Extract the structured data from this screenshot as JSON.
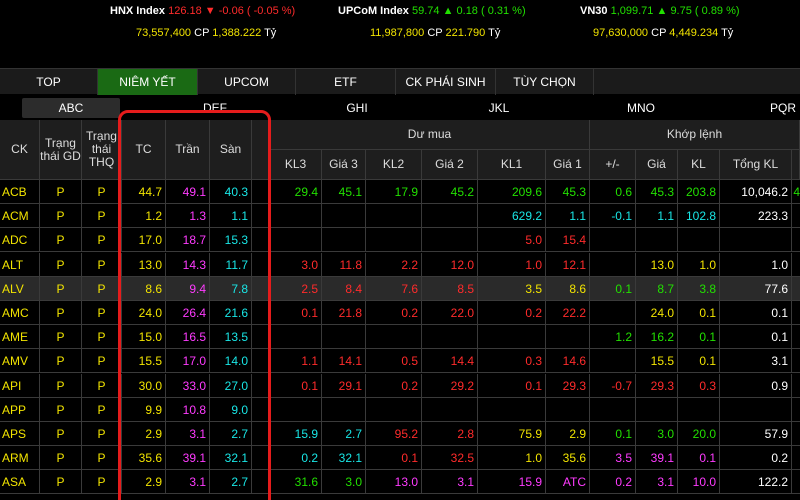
{
  "indices": [
    {
      "name": "HNX Index",
      "value": "126.18",
      "arrow": "▼",
      "change": "-0.06",
      "pct": "( -0.05 %)",
      "color": "#ff2b2b",
      "volume": "73,557,400",
      "cp": "CP",
      "turnover": "1,388.222",
      "unit": "Tỷ"
    },
    {
      "name": "UPCoM Index",
      "value": "59.74",
      "arrow": "▲",
      "change": "0.18",
      "pct": "( 0.31 %)",
      "color": "#22e000",
      "volume": "11,987,800",
      "cp": "CP",
      "turnover": "221.790",
      "unit": "Tỷ"
    },
    {
      "name": "VN30",
      "value": "1,099.71",
      "arrow": "▲",
      "change": "9.75",
      "pct": "( 0.89 %)",
      "color": "#22e000",
      "volume": "97,630,000",
      "cp": "CP",
      "turnover": "4,449.234",
      "unit": "Tỷ"
    }
  ],
  "tabs": [
    {
      "label": "TOP",
      "active": false
    },
    {
      "label": "NIÊM YẾT",
      "active": true
    },
    {
      "label": "UPCOM",
      "active": false
    },
    {
      "label": "ETF",
      "active": false
    },
    {
      "label": "CK PHÁI SINH",
      "active": false
    },
    {
      "label": "TÙY CHỌN",
      "active": false
    }
  ],
  "alpha": [
    "ABC",
    "DEF",
    "GHI",
    "JKL",
    "MNO",
    "PQR"
  ],
  "headers": {
    "ck": "CK",
    "trangthai_gd": "Trạng thái GD",
    "trangthai_thq": "Trạng thái THQ",
    "tc": "TC",
    "tran": "Trần",
    "san": "Sàn",
    "du_mua": "Dư mua",
    "khop_lenh": "Khớp lệnh",
    "kl3": "KL3",
    "gia3": "Giá 3",
    "kl2": "KL2",
    "gia2": "Giá 2",
    "kl1": "KL1",
    "gia1": "Giá 1",
    "change": "+/-",
    "gia": "Giá",
    "kl": "KL",
    "tong_kl": "Tổng KL"
  },
  "colors": {
    "up": "#22e000",
    "down": "#ff2b2b",
    "ref": "#f2e400",
    "ceil": "#ff3bff",
    "floor": "#19e6e6",
    "white": "#ffffff"
  },
  "rows": [
    {
      "ck": "ACB",
      "gd": "P",
      "thq": "P",
      "tc": "44.7",
      "tran": "49.1",
      "san": "40.3",
      "kl3": [
        "29.4",
        "up"
      ],
      "gia3": [
        "45.1",
        "up"
      ],
      "kl2": [
        "17.9",
        "up"
      ],
      "gia2": [
        "45.2",
        "up"
      ],
      "kl1": [
        "209.6",
        "up"
      ],
      "gia1": [
        "45.3",
        "up"
      ],
      "chg": [
        "0.6",
        "up"
      ],
      "gia": [
        "45.3",
        "up"
      ],
      "kl": [
        "203.8",
        "up"
      ],
      "tkl": [
        "10,046.2",
        "white"
      ],
      "extra": [
        "4",
        "up"
      ]
    },
    {
      "ck": "ACM",
      "gd": "P",
      "thq": "P",
      "tc": "1.2",
      "tran": "1.3",
      "san": "1.1",
      "kl3": [
        "",
        ""
      ],
      "gia3": [
        "",
        ""
      ],
      "kl2": [
        "",
        ""
      ],
      "gia2": [
        "",
        ""
      ],
      "kl1": [
        "629.2",
        "floor"
      ],
      "gia1": [
        "1.1",
        "floor"
      ],
      "chg": [
        "-0.1",
        "floor"
      ],
      "gia": [
        "1.1",
        "floor"
      ],
      "kl": [
        "102.8",
        "floor"
      ],
      "tkl": [
        "223.3",
        "white"
      ],
      "extra": [
        "",
        ""
      ]
    },
    {
      "ck": "ADC",
      "gd": "P",
      "thq": "P",
      "tc": "17.0",
      "tran": "18.7",
      "san": "15.3",
      "kl3": [
        "",
        ""
      ],
      "gia3": [
        "",
        ""
      ],
      "kl2": [
        "",
        ""
      ],
      "gia2": [
        "",
        ""
      ],
      "kl1": [
        "5.0",
        "down"
      ],
      "gia1": [
        "15.4",
        "down"
      ],
      "chg": [
        "",
        ""
      ],
      "gia": [
        "",
        ""
      ],
      "kl": [
        "",
        ""
      ],
      "tkl": [
        "",
        ""
      ],
      "extra": [
        "",
        ""
      ]
    },
    {
      "ck": "ALT",
      "gd": "P",
      "thq": "P",
      "tc": "13.0",
      "tran": "14.3",
      "san": "11.7",
      "kl3": [
        "3.0",
        "down"
      ],
      "gia3": [
        "11.8",
        "down"
      ],
      "kl2": [
        "2.2",
        "down"
      ],
      "gia2": [
        "12.0",
        "down"
      ],
      "kl1": [
        "1.0",
        "down"
      ],
      "gia1": [
        "12.1",
        "down"
      ],
      "chg": [
        "",
        ""
      ],
      "gia": [
        "13.0",
        "ref"
      ],
      "kl": [
        "1.0",
        "ref"
      ],
      "tkl": [
        "1.0",
        "white"
      ],
      "extra": [
        "",
        ""
      ]
    },
    {
      "ck": "ALV",
      "gd": "P",
      "thq": "P",
      "tc": "8.6",
      "tran": "9.4",
      "san": "7.8",
      "kl3": [
        "2.5",
        "down"
      ],
      "gia3": [
        "8.4",
        "down"
      ],
      "kl2": [
        "7.6",
        "down"
      ],
      "gia2": [
        "8.5",
        "down"
      ],
      "kl1": [
        "3.5",
        "ref"
      ],
      "gia1": [
        "8.6",
        "ref"
      ],
      "chg": [
        "0.1",
        "up"
      ],
      "gia": [
        "8.7",
        "up"
      ],
      "kl": [
        "3.8",
        "up"
      ],
      "tkl": [
        "77.6",
        "white"
      ],
      "extra": [
        "",
        ""
      ]
    },
    {
      "ck": "AMC",
      "gd": "P",
      "thq": "P",
      "tc": "24.0",
      "tran": "26.4",
      "san": "21.6",
      "kl3": [
        "0.1",
        "down"
      ],
      "gia3": [
        "21.8",
        "down"
      ],
      "kl2": [
        "0.2",
        "down"
      ],
      "gia2": [
        "22.0",
        "down"
      ],
      "kl1": [
        "0.2",
        "down"
      ],
      "gia1": [
        "22.2",
        "down"
      ],
      "chg": [
        "",
        ""
      ],
      "gia": [
        "24.0",
        "ref"
      ],
      "kl": [
        "0.1",
        "ref"
      ],
      "tkl": [
        "0.1",
        "white"
      ],
      "extra": [
        "",
        ""
      ]
    },
    {
      "ck": "AME",
      "gd": "P",
      "thq": "P",
      "tc": "15.0",
      "tran": "16.5",
      "san": "13.5",
      "kl3": [
        "",
        ""
      ],
      "gia3": [
        "",
        ""
      ],
      "kl2": [
        "",
        ""
      ],
      "gia2": [
        "",
        ""
      ],
      "kl1": [
        "",
        ""
      ],
      "gia1": [
        "",
        ""
      ],
      "chg": [
        "1.2",
        "up"
      ],
      "gia": [
        "16.2",
        "up"
      ],
      "kl": [
        "0.1",
        "up"
      ],
      "tkl": [
        "0.1",
        "white"
      ],
      "extra": [
        "",
        ""
      ]
    },
    {
      "ck": "AMV",
      "gd": "P",
      "thq": "P",
      "tc": "15.5",
      "tran": "17.0",
      "san": "14.0",
      "kl3": [
        "1.1",
        "down"
      ],
      "gia3": [
        "14.1",
        "down"
      ],
      "kl2": [
        "0.5",
        "down"
      ],
      "gia2": [
        "14.4",
        "down"
      ],
      "kl1": [
        "0.3",
        "down"
      ],
      "gia1": [
        "14.6",
        "down"
      ],
      "chg": [
        "",
        ""
      ],
      "gia": [
        "15.5",
        "ref"
      ],
      "kl": [
        "0.1",
        "ref"
      ],
      "tkl": [
        "3.1",
        "white"
      ],
      "extra": [
        "",
        ""
      ]
    },
    {
      "ck": "API",
      "gd": "P",
      "thq": "P",
      "tc": "30.0",
      "tran": "33.0",
      "san": "27.0",
      "kl3": [
        "0.1",
        "down"
      ],
      "gia3": [
        "29.1",
        "down"
      ],
      "kl2": [
        "0.2",
        "down"
      ],
      "gia2": [
        "29.2",
        "down"
      ],
      "kl1": [
        "0.1",
        "down"
      ],
      "gia1": [
        "29.3",
        "down"
      ],
      "chg": [
        "-0.7",
        "down"
      ],
      "gia": [
        "29.3",
        "down"
      ],
      "kl": [
        "0.3",
        "down"
      ],
      "tkl": [
        "0.9",
        "white"
      ],
      "extra": [
        "",
        ""
      ]
    },
    {
      "ck": "APP",
      "gd": "P",
      "thq": "P",
      "tc": "9.9",
      "tran": "10.8",
      "san": "9.0",
      "kl3": [
        "",
        ""
      ],
      "gia3": [
        "",
        ""
      ],
      "kl2": [
        "",
        ""
      ],
      "gia2": [
        "",
        ""
      ],
      "kl1": [
        "",
        ""
      ],
      "gia1": [
        "",
        ""
      ],
      "chg": [
        "",
        ""
      ],
      "gia": [
        "",
        ""
      ],
      "kl": [
        "",
        ""
      ],
      "tkl": [
        "",
        ""
      ],
      "extra": [
        "",
        ""
      ]
    },
    {
      "ck": "APS",
      "gd": "P",
      "thq": "P",
      "tc": "2.9",
      "tran": "3.1",
      "san": "2.7",
      "kl3": [
        "15.9",
        "floor"
      ],
      "gia3": [
        "2.7",
        "floor"
      ],
      "kl2": [
        "95.2",
        "down"
      ],
      "gia2": [
        "2.8",
        "down"
      ],
      "kl1": [
        "75.9",
        "ref"
      ],
      "gia1": [
        "2.9",
        "ref"
      ],
      "chg": [
        "0.1",
        "up"
      ],
      "gia": [
        "3.0",
        "up"
      ],
      "kl": [
        "20.0",
        "up"
      ],
      "tkl": [
        "57.9",
        "white"
      ],
      "extra": [
        "",
        ""
      ]
    },
    {
      "ck": "ARM",
      "gd": "P",
      "thq": "P",
      "tc": "35.6",
      "tran": "39.1",
      "san": "32.1",
      "kl3": [
        "0.2",
        "floor"
      ],
      "gia3": [
        "32.1",
        "floor"
      ],
      "kl2": [
        "0.1",
        "down"
      ],
      "gia2": [
        "32.5",
        "down"
      ],
      "kl1": [
        "1.0",
        "ref"
      ],
      "gia1": [
        "35.6",
        "ref"
      ],
      "chg": [
        "3.5",
        "ceil"
      ],
      "gia": [
        "39.1",
        "ceil"
      ],
      "kl": [
        "0.1",
        "ceil"
      ],
      "tkl": [
        "0.2",
        "white"
      ],
      "extra": [
        "",
        ""
      ]
    },
    {
      "ck": "ASA",
      "gd": "P",
      "thq": "P",
      "tc": "2.9",
      "tran": "3.1",
      "san": "2.7",
      "kl3": [
        "31.6",
        "up"
      ],
      "gia3": [
        "3.0",
        "up"
      ],
      "kl2": [
        "13.0",
        "ceil"
      ],
      "gia2": [
        "3.1",
        "ceil"
      ],
      "kl1": [
        "15.9",
        "ceil"
      ],
      "gia1": [
        "ATC",
        "ceil"
      ],
      "chg": [
        "0.2",
        "ceil"
      ],
      "gia": [
        "3.1",
        "ceil"
      ],
      "kl": [
        "10.0",
        "ceil"
      ],
      "tkl": [
        "122.2",
        "white"
      ],
      "extra": [
        "",
        ""
      ]
    }
  ]
}
